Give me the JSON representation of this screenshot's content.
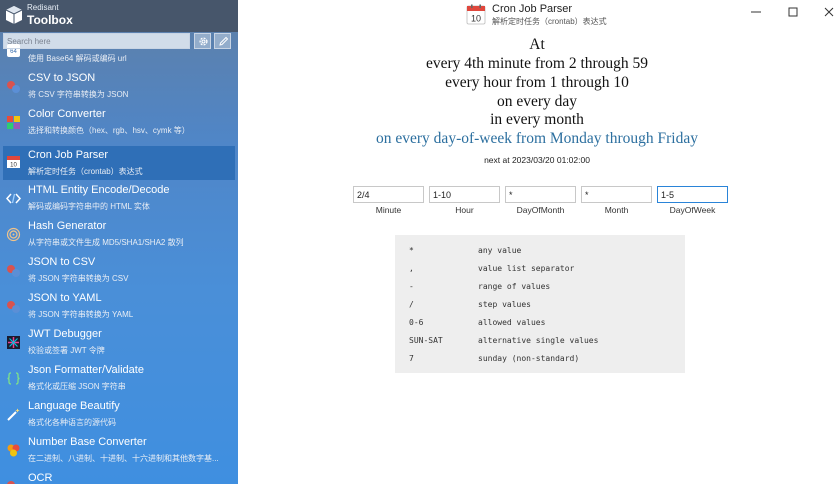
{
  "brand": {
    "line1": "Redisant",
    "line2": "Toolbox"
  },
  "search": {
    "placeholder": "Search here"
  },
  "sidebar": {
    "items": [
      {
        "name": "",
        "desc": "使用 Base64 解码或编码 url",
        "icon": "base64-icon"
      },
      {
        "name": "CSV to JSON",
        "desc": "将 CSV 字符串转换为 JSON",
        "icon": "csv-json-icon"
      },
      {
        "name": "Color Converter",
        "desc": "选择和转换颜色（hex、rgb、hsv、cymk 等）",
        "icon": "color-palette-icon"
      },
      {
        "name": "Cron Job Parser",
        "desc": "解析定时任务（crontab）表达式",
        "icon": "calendar-icon",
        "selected": true
      },
      {
        "name": "HTML Entity Encode/Decode",
        "desc": "解码或编码字符串中的 HTML 实体",
        "icon": "code-brackets-icon"
      },
      {
        "name": "Hash Generator",
        "desc": "从字符串或文件生成 MD5/SHA1/SHA2 散列",
        "icon": "fingerprint-icon"
      },
      {
        "name": "JSON to CSV",
        "desc": "将 JSON 字符串转换为 CSV",
        "icon": "json-csv-icon"
      },
      {
        "name": "JSON to YAML",
        "desc": "将 JSON 字符串转换为 YAML",
        "icon": "json-yaml-icon"
      },
      {
        "name": "JWT Debugger",
        "desc": "校验或签署 JWT 令牌",
        "icon": "jwt-icon"
      },
      {
        "name": "Json Formatter/Validate",
        "desc": "格式化或压缩 JSON 字符串",
        "icon": "curly-braces-icon"
      },
      {
        "name": "Language Beautify",
        "desc": "格式化各种语言的源代码",
        "icon": "magic-wand-icon"
      },
      {
        "name": "Number Base Converter",
        "desc": "在二进制、八进制、十进制、十六进制和其他数字基...",
        "icon": "number-base-icon"
      },
      {
        "name": "OCR",
        "desc": "",
        "icon": "ocr-icon"
      }
    ]
  },
  "titlebar": {
    "title": "Cron Job Parser",
    "subtitle": "解析定时任务（crontab）表达式",
    "icon_day": "10"
  },
  "description": {
    "line1": "At",
    "line2": "every 4th minute from 2 through 59",
    "line3": "every hour from 1 through 10",
    "line4": "on every day",
    "line5": "in every month",
    "line6": "on every day-of-week from Monday through Friday"
  },
  "next_run": "next at 2023/03/20 01:02:00",
  "fields": [
    {
      "label": "Minute",
      "value": "2/4"
    },
    {
      "label": "Hour",
      "value": "1-10"
    },
    {
      "label": "DayOfMonth",
      "value": "*"
    },
    {
      "label": "Month",
      "value": "*"
    },
    {
      "label": "DayOfWeek",
      "value": "1-5"
    }
  ],
  "legend": [
    {
      "symbol": "*",
      "meaning": "any value"
    },
    {
      "symbol": ",",
      "meaning": "value list separator"
    },
    {
      "symbol": "-",
      "meaning": "range of values"
    },
    {
      "symbol": "/",
      "meaning": "step values"
    },
    {
      "symbol": "0-6",
      "meaning": "allowed values"
    },
    {
      "symbol": "SUN-SAT",
      "meaning": "alternative single values"
    },
    {
      "symbol": "7",
      "meaning": "sunday (non-standard)"
    }
  ],
  "colors": {
    "sidebar_selected": "#2f6fb7",
    "description_highlight": "#2c6f9f",
    "focus_border": "#2a84d8"
  }
}
